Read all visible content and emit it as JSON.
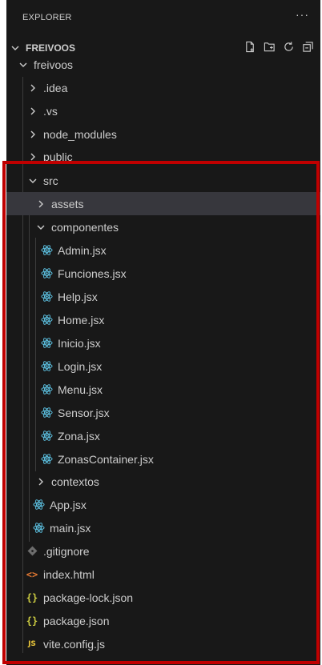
{
  "explorer": {
    "title": "EXPLORER",
    "more_icon": "ellipsis-icon",
    "root_folder": "FREIVOOS",
    "root_actions": [
      "new-file-icon",
      "new-folder-icon",
      "refresh-icon",
      "collapse-all-icon"
    ]
  },
  "tree": {
    "freivoos": ".freivoos",
    "idea": ".idea",
    "vs": ".vs",
    "node_modules": "node_modules",
    "public": "public",
    "src": "src",
    "assets": "assets",
    "componentes": "componentes",
    "components_files": [
      "Admin.jsx",
      "Funciones.jsx",
      "Help.jsx",
      "Home.jsx",
      "Inicio.jsx",
      "Login.jsx",
      "Menu.jsx",
      "Sensor.jsx",
      "Zona.jsx",
      "ZonasContainer.jsx"
    ],
    "contextos": "contextos",
    "app_jsx": "App.jsx",
    "main_jsx": "main.jsx",
    "gitignore": ".gitignore",
    "index_html": "index.html",
    "package_lock": "package-lock.json",
    "package_json": "package.json",
    "vite_config": "vite.config.js"
  },
  "icons": {
    "js_badge": "JS",
    "braces": "{}",
    "html": "<>"
  },
  "colors": {
    "panel_bg": "#181818",
    "selected_row": "#37373d",
    "react_icon": "#5ec5e6",
    "highlight_border": "#c00000",
    "json_icon": "#cbcb41",
    "html_icon": "#e37933",
    "js_icon": "#e8c53a"
  }
}
